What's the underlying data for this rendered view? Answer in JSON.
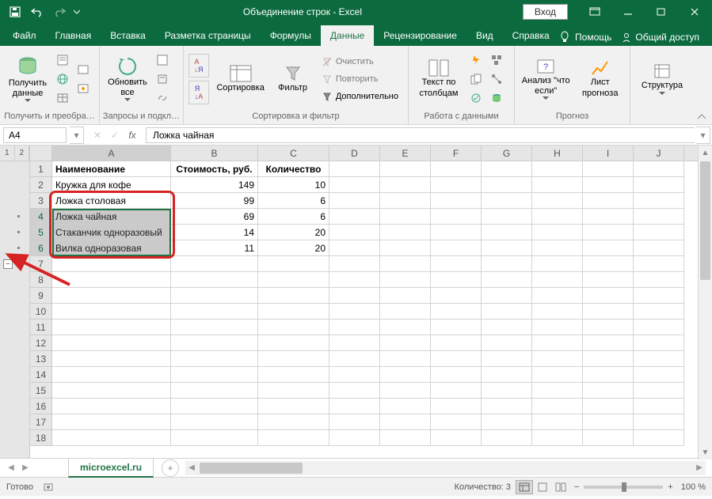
{
  "titlebar": {
    "title": "Объединение строк  -  Excel",
    "login": "Вход"
  },
  "tabs": {
    "file": "Файл",
    "home": "Главная",
    "insert": "Вставка",
    "layout": "Разметка страницы",
    "formulas": "Формулы",
    "data": "Данные",
    "review": "Рецензирование",
    "view": "Вид",
    "help": "Справка",
    "tellme": "Помощь",
    "share": "Общий доступ"
  },
  "ribbon": {
    "get_data": "Получить данные",
    "group1_label": "Получить и преобра…",
    "refresh_all": "Обновить все",
    "group2_label": "Запросы и подкл…",
    "sort_az": "А↓Я",
    "sort_za": "Я↓А",
    "sort": "Сортировка",
    "filter": "Фильтр",
    "clear": "Очистить",
    "reapply": "Повторить",
    "advanced": "Дополнительно",
    "group3_label": "Сортировка и фильтр",
    "text_to_cols": "Текст по столбцам",
    "group4_label": "Работа с данными",
    "whatif": "Анализ \"что если\"",
    "forecast": "Лист прогноза",
    "group5_label": "Прогноз",
    "structure": "Структура",
    "group6_label": ""
  },
  "formula_bar": {
    "name_box": "A4",
    "formula": "Ложка чайная"
  },
  "columns": [
    "A",
    "B",
    "C",
    "D",
    "E",
    "F",
    "G",
    "H",
    "I",
    "J"
  ],
  "outline_header": [
    "1",
    "2"
  ],
  "data_rows": [
    {
      "n": 1,
      "a": "Наименование",
      "b": "Стоимость, руб.",
      "c": "Количество",
      "hdr": true
    },
    {
      "n": 2,
      "a": "Кружка для кофе",
      "b": "149",
      "c": "10"
    },
    {
      "n": 3,
      "a": "Ложка столовая",
      "b": "99",
      "c": "6"
    },
    {
      "n": 4,
      "a": "Ложка чайная",
      "b": "69",
      "c": "6",
      "sel": true
    },
    {
      "n": 5,
      "a": "Стаканчик одноразовый",
      "b": "14",
      "c": "20",
      "sel": true
    },
    {
      "n": 6,
      "a": "Вилка одноразовая",
      "b": "11",
      "c": "20",
      "sel": true
    },
    {
      "n": 7
    },
    {
      "n": 8
    },
    {
      "n": 9
    },
    {
      "n": 10
    },
    {
      "n": 11
    },
    {
      "n": 12
    },
    {
      "n": 13
    },
    {
      "n": 14
    },
    {
      "n": 15
    },
    {
      "n": 16
    },
    {
      "n": 17
    },
    {
      "n": 18
    }
  ],
  "sheet_tabs": {
    "active": "microexcel.ru"
  },
  "statusbar": {
    "ready": "Готово",
    "count_label": "Количество: 3",
    "zoom": "100 %"
  }
}
